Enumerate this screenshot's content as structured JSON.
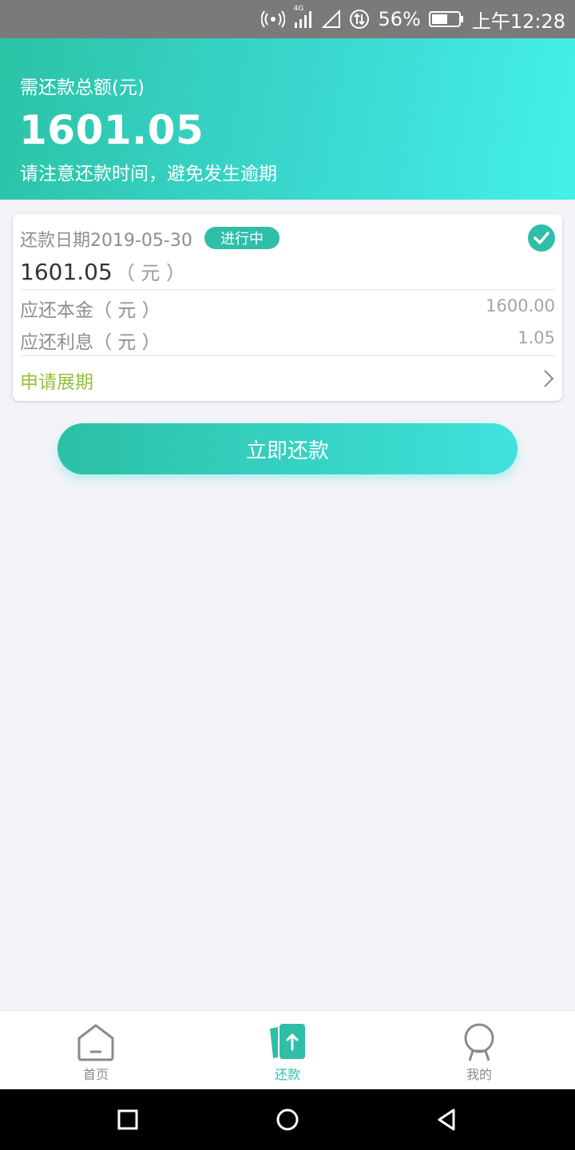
{
  "status_bar": {
    "network_label": "4G",
    "battery_percent": "56%",
    "time": "上午12:28"
  },
  "header": {
    "label": "需还款总额(元)",
    "amount": "1601.05",
    "tip": "请注意还款时间，避免发生逾期"
  },
  "card": {
    "due_date": "还款日期2019-05-30",
    "status": "进行中",
    "amount": "1601.05",
    "amount_unit": "（ 元 ）",
    "principal_label": "应还本金（ 元 ）",
    "principal_value": "1600.00",
    "interest_label": "应还利息（ 元 ）",
    "interest_value": "1.05",
    "extend_label": "申请展期"
  },
  "pay_button": "立即还款",
  "tabs": [
    {
      "label": "首页",
      "icon": "home-icon"
    },
    {
      "label": "还款",
      "icon": "repay-icon"
    },
    {
      "label": "我的",
      "icon": "profile-icon"
    }
  ],
  "colors": {
    "accent": "#2fbea7",
    "accent_light": "#44f1e8",
    "extend_green": "#93c13a"
  }
}
